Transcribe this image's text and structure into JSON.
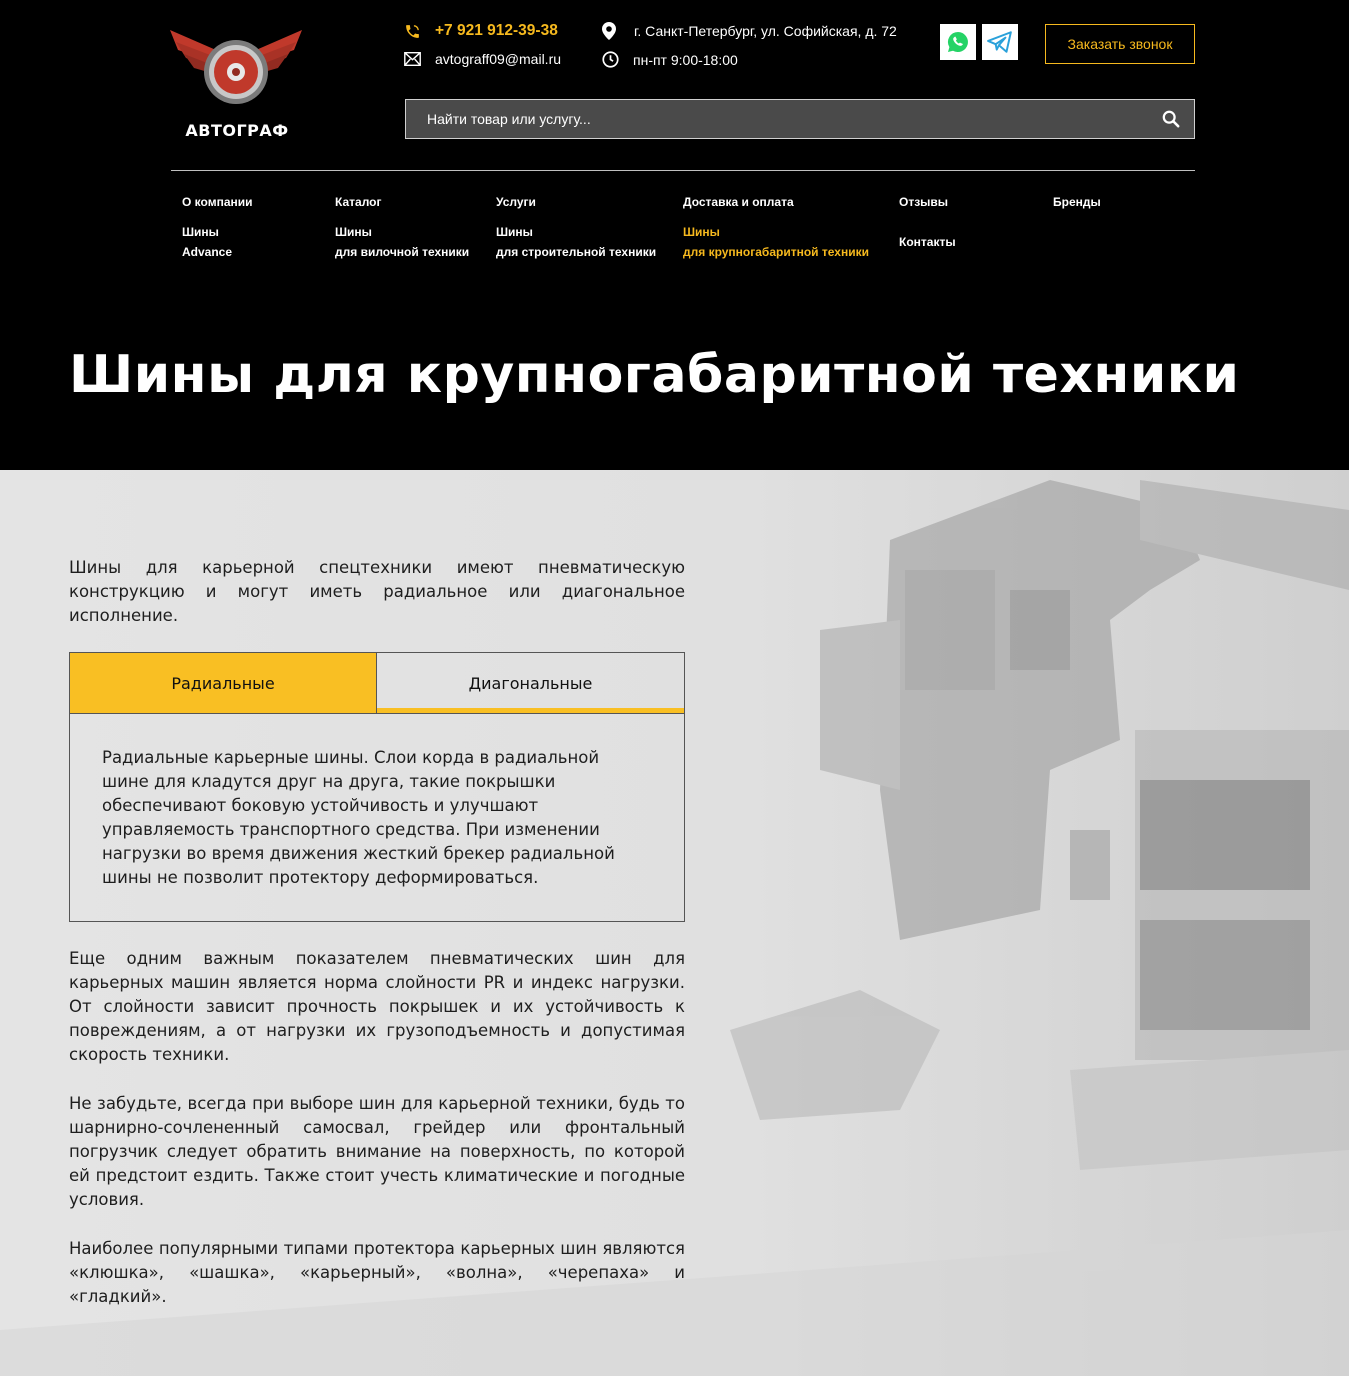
{
  "header": {
    "logo_text": "АВТОГРАФ",
    "phone": "+7 921 912-39-38",
    "email": "avtograff09@mail.ru",
    "address": "г. Санкт-Петербург, ул. Софийская, д. 72",
    "hours": "пн-пт 9:00-18:00",
    "call_button": "Заказать звонок",
    "search_placeholder": "Найти товар или услугу..."
  },
  "nav": {
    "row1": [
      "О компании",
      "Каталог",
      "Услуги",
      "Доставка и оплата",
      "Отзывы",
      "Бренды"
    ],
    "row2": [
      {
        "line1": "Шины",
        "line2": "Advance"
      },
      {
        "line1": "Шины",
        "line2": "для вилочной техники"
      },
      {
        "line1": "Шины",
        "line2": "для строительной техники"
      },
      {
        "line1": "Шины",
        "line2": "для крупногабаритной техники"
      }
    ],
    "contacts": "Контакты"
  },
  "page_title": "Шины для крупногабаритной техники",
  "content": {
    "intro": "Шины для карьерной спецтехники имеют пневматическую конструкцию и могут иметь радиальное или диагональное исполнение.",
    "tabs": [
      "Радиальные",
      "Диагональные"
    ],
    "tab_text": "Радиальные карьерные шины. Слои корда в радиальной шине для кладутся друг на друга, такие покрышки обеспечивают боковую устойчивость и улучшают управляемость транспортного средства. При изменении нагрузки во время движения жесткий брекер радиальной шины не позволит протектору деформироваться.",
    "p2": "Еще одним важным показателем пневматических шин для карьерных машин является норма слойности PR и индекс нагрузки. От слойности зависит прочность покрышек и их устойчивость к повреждениям, а от нагрузки их грузоподъемность и допустимая скорость техники.",
    "p3": "Не забудьте, всегда при выборе шин для карьерной техники, будь то шарнирно-сочлененный самосвал, грейдер или фронтальный погрузчик следует обратить внимание на поверхность, по которой ей предстоит ездить. Также стоит учесть климатические и погодные условия.",
    "p4": "Наиболее популярными типами протектора карьерных шин являются «клюшка», «шашка», «карьерный», «волна», «черепаха» и «гладкий»."
  },
  "colors": {
    "accent": "#f6b91e",
    "tab_active": "#f9bf23",
    "header_bg": "#000000",
    "content_bg": "#e4e4e4"
  },
  "icons": [
    "phone-icon",
    "mail-icon",
    "location-icon",
    "clock-icon",
    "whatsapp-icon",
    "telegram-icon",
    "search-icon",
    "logo-emblem"
  ]
}
